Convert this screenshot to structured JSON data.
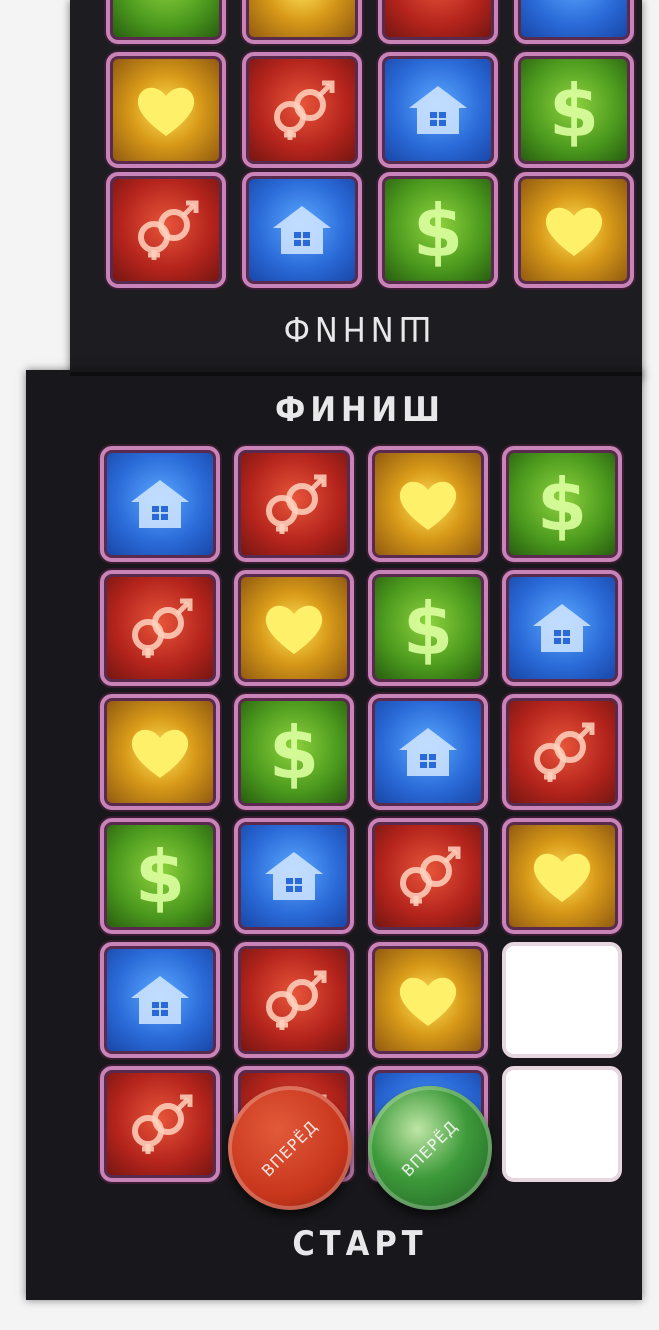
{
  "board": {
    "mirrored_finish_label": "ФИНИШ",
    "finish_label": "ФИНИШ",
    "start_label": "СТАРТ"
  },
  "colors": {
    "house": "#2a6ad8",
    "gender": "#b4241c",
    "heart": "#d89a18",
    "money": "#4c9a1e",
    "frame": "#c884b8"
  },
  "top_section": {
    "rows": [
      [
        "heart",
        "gender",
        "house",
        "money"
      ],
      [
        "gender",
        "house",
        "money",
        "heart"
      ]
    ]
  },
  "bottom_section": {
    "rows": [
      [
        "house",
        "gender",
        "heart",
        "money"
      ],
      [
        "gender",
        "heart",
        "money",
        "house"
      ],
      [
        "heart",
        "money",
        "house",
        "gender"
      ],
      [
        "money",
        "house",
        "gender",
        "heart"
      ],
      [
        "house",
        "gender",
        "heart",
        "blank"
      ],
      [
        "gender",
        "gender",
        "house",
        "blank"
      ]
    ]
  },
  "chips": [
    {
      "color": "red",
      "label": "ВПЕРЁД"
    },
    {
      "color": "green",
      "label": "ВПЕРЁД"
    }
  ]
}
